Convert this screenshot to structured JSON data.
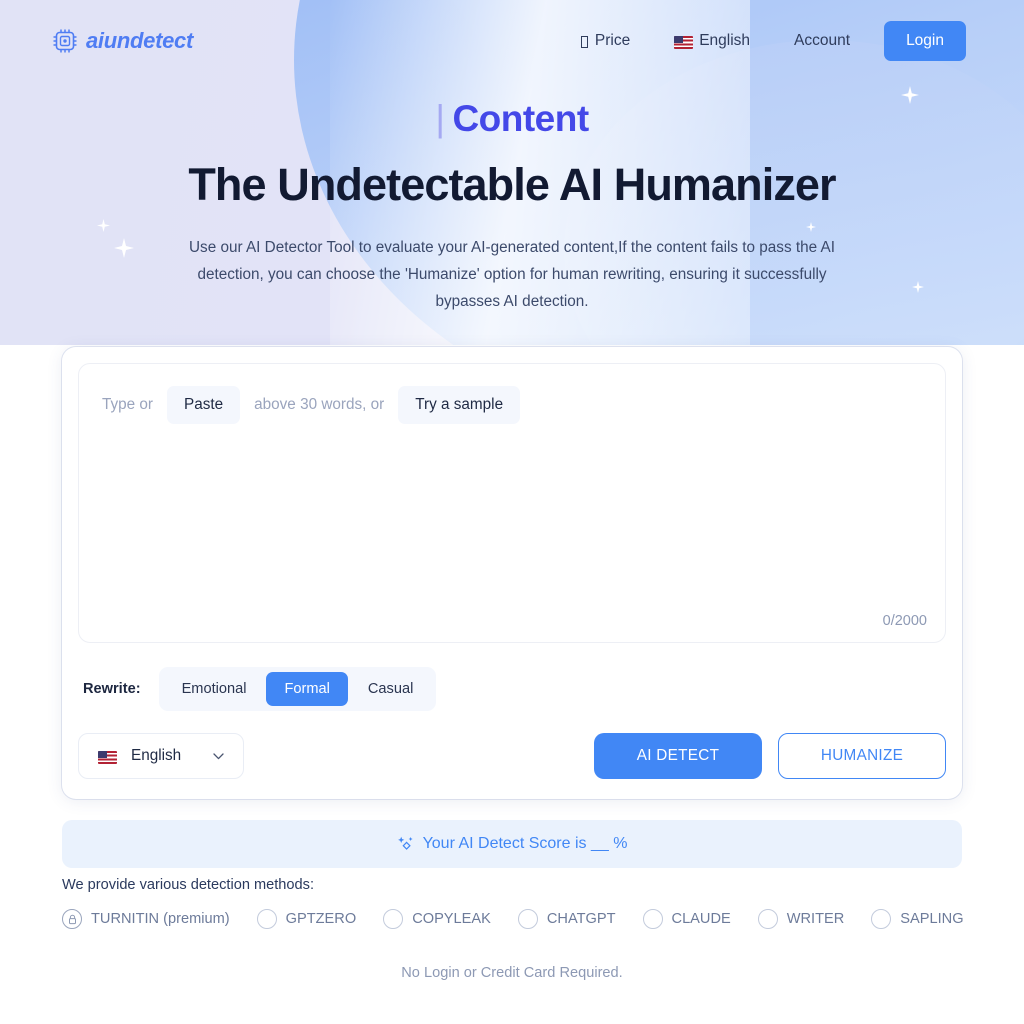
{
  "brand": {
    "name": "aiundetect",
    "logo_icon": "chip-icon",
    "accent": "#4187f5",
    "logo_color": "#4f7df3"
  },
  "header": {
    "nav": [
      {
        "label": "Price",
        "icon": "missing-glyph",
        "name": "nav-price"
      },
      {
        "label": "English",
        "icon": "us-flag-icon",
        "name": "nav-language"
      },
      {
        "label": "Account",
        "icon": "",
        "name": "nav-account"
      }
    ],
    "login_label": "Login"
  },
  "hero": {
    "eyebrow_bar": "|",
    "eyebrow": "Content",
    "title": "The Undetectable AI Humanizer",
    "subtitle": "Use our AI Detector Tool to evaluate your AI-generated content,If the content fails to pass the AI detection, you can choose the 'Humanize' option for human rewriting, ensuring it successfully bypasses AI detection."
  },
  "editor": {
    "placeholder_prefix": "Type or",
    "paste_label": "Paste",
    "placeholder_middle": "above 30 words, or",
    "sample_label": "Try a sample",
    "textarea_value": "",
    "counter": "0/2000"
  },
  "rewrite": {
    "label": "Rewrite:",
    "options": [
      {
        "label": "Emotional",
        "active": false
      },
      {
        "label": "Formal",
        "active": true
      },
      {
        "label": "Casual",
        "active": false
      }
    ],
    "selected": "Formal"
  },
  "language_select": {
    "value": "English",
    "flag_icon": "us-flag-icon",
    "chevron_icon": "chevron-down-icon"
  },
  "actions": {
    "detect_label": "AI DETECT",
    "humanize_label": "HUMANIZE"
  },
  "score": {
    "icon": "sparkle-icon",
    "text": "Your AI Detect Score is __ %"
  },
  "methods": {
    "label": "We provide various detection methods:",
    "items": [
      {
        "label": "TURNITIN (premium)",
        "locked": true,
        "icon": "lock-icon"
      },
      {
        "label": "GPTZERO",
        "locked": false,
        "icon": "radio-icon"
      },
      {
        "label": "COPYLEAK",
        "locked": false,
        "icon": "radio-icon"
      },
      {
        "label": "CHATGPT",
        "locked": false,
        "icon": "radio-icon"
      },
      {
        "label": "CLAUDE",
        "locked": false,
        "icon": "radio-icon"
      },
      {
        "label": "WRITER",
        "locked": false,
        "icon": "radio-icon"
      },
      {
        "label": "SAPLING",
        "locked": false,
        "icon": "radio-icon"
      }
    ]
  },
  "footnote": "No Login or Credit Card Required."
}
